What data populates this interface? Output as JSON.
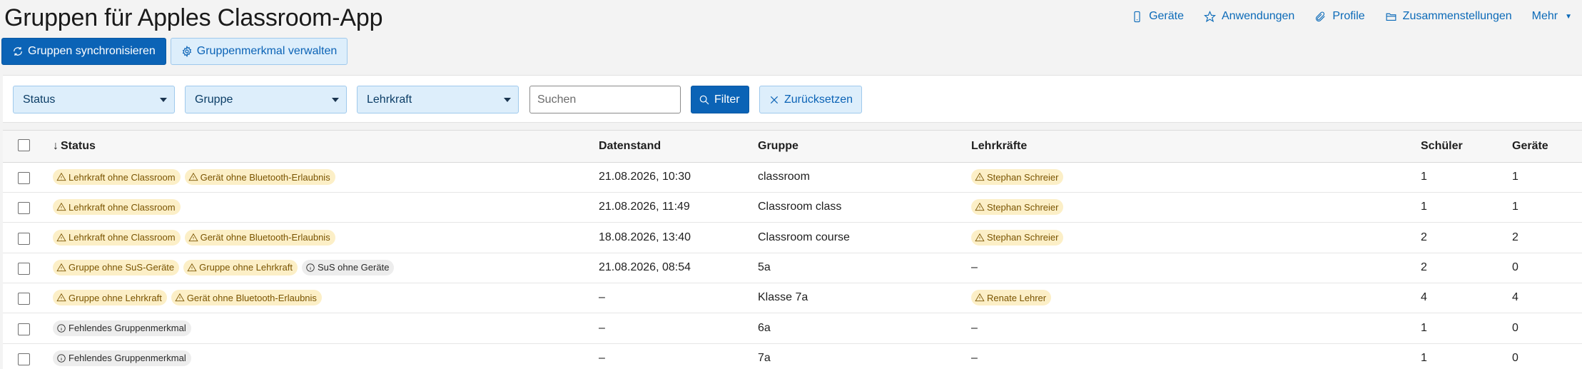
{
  "page": {
    "title": "Gruppen für Apples Classroom-App"
  },
  "topnav": {
    "devices": "Geräte",
    "apps": "Anwendungen",
    "profiles": "Profile",
    "compositions": "Zusammenstellungen",
    "more": "Mehr"
  },
  "actions": {
    "sync": "Gruppen synchronisieren",
    "manage": "Gruppenmerkmal verwalten"
  },
  "filters": {
    "status": "Status",
    "group": "Gruppe",
    "teacher": "Lehrkraft",
    "search_placeholder": "Suchen",
    "filter": "Filter",
    "reset": "Zurücksetzen"
  },
  "table": {
    "headers": {
      "status": "Status",
      "datenstand": "Datenstand",
      "gruppe": "Gruppe",
      "lehrkraefte": "Lehrkräfte",
      "schueler": "Schüler",
      "geraete": "Geräte"
    },
    "rows": [
      {
        "status": [
          {
            "type": "warn",
            "icon": "warning-icon",
            "text": "Lehrkraft ohne Classroom"
          },
          {
            "type": "warn",
            "icon": "warning-icon",
            "text": "Gerät ohne Bluetooth-Erlaubnis"
          }
        ],
        "datenstand": "21.08.2026, 10:30",
        "gruppe": "classroom",
        "teacher_badge": "Stephan Schreier",
        "teacher_text": "",
        "schueler": "1",
        "geraete": "1"
      },
      {
        "status": [
          {
            "type": "warn",
            "icon": "warning-icon",
            "text": "Lehrkraft ohne Classroom"
          }
        ],
        "datenstand": "21.08.2026, 11:49",
        "gruppe": "Classroom class",
        "teacher_badge": "Stephan Schreier",
        "teacher_text": "",
        "schueler": "1",
        "geraete": "1"
      },
      {
        "status": [
          {
            "type": "warn",
            "icon": "warning-icon",
            "text": "Lehrkraft ohne Classroom"
          },
          {
            "type": "warn",
            "icon": "warning-icon",
            "text": "Gerät ohne Bluetooth-Erlaubnis"
          }
        ],
        "datenstand": "18.08.2026, 13:40",
        "gruppe": "Classroom course",
        "teacher_badge": "Stephan Schreier",
        "teacher_text": "",
        "schueler": "2",
        "geraete": "2"
      },
      {
        "status": [
          {
            "type": "warn",
            "icon": "warning-icon",
            "text": "Gruppe ohne SuS-Geräte"
          },
          {
            "type": "warn",
            "icon": "warning-icon",
            "text": "Gruppe ohne Lehrkraft"
          },
          {
            "type": "info",
            "icon": "info-icon",
            "text": "SuS ohne Geräte"
          }
        ],
        "datenstand": "21.08.2026, 08:54",
        "gruppe": "5a",
        "teacher_badge": "",
        "teacher_text": "–",
        "schueler": "2",
        "geraete": "0"
      },
      {
        "status": [
          {
            "type": "warn",
            "icon": "warning-icon",
            "text": "Gruppe ohne Lehrkraft"
          },
          {
            "type": "warn",
            "icon": "warning-icon",
            "text": "Gerät ohne Bluetooth-Erlaubnis"
          }
        ],
        "datenstand": "–",
        "gruppe": "Klasse 7a",
        "teacher_badge": "Renate Lehrer",
        "teacher_text": "",
        "schueler": "4",
        "geraete": "4"
      },
      {
        "status": [
          {
            "type": "info",
            "icon": "info-icon",
            "text": "Fehlendes Gruppenmerkmal"
          }
        ],
        "datenstand": "–",
        "gruppe": "6a",
        "teacher_badge": "",
        "teacher_text": "–",
        "schueler": "1",
        "geraete": "0"
      },
      {
        "status": [
          {
            "type": "info",
            "icon": "info-icon",
            "text": "Fehlendes Gruppenmerkmal"
          }
        ],
        "datenstand": "–",
        "gruppe": "7a",
        "teacher_badge": "",
        "teacher_text": "–",
        "schueler": "1",
        "geraete": "0"
      }
    ]
  }
}
